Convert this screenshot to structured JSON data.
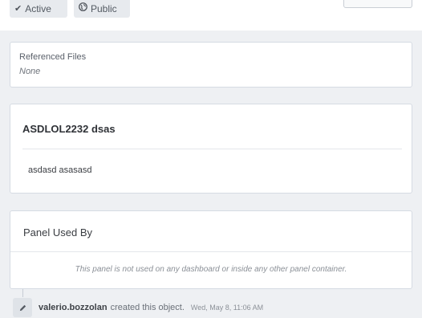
{
  "tags": {
    "active": {
      "icon": "checkmark-icon",
      "label": "Active"
    },
    "public": {
      "icon": "globe-icon",
      "label": "Public"
    }
  },
  "referenced_files": {
    "label": "Referenced Files",
    "value": "None"
  },
  "panel": {
    "title": "ASDLOL2232 dsas",
    "body": "asdasd asasasd"
  },
  "used_by": {
    "title": "Panel Used By",
    "empty_text": "This panel is not used on any dashboard or inside any other panel container."
  },
  "feed": {
    "icon": "pencil-icon",
    "user": "valerio.bozzolan",
    "action": "created this object.",
    "time": "Wed, May 8, 11:06 AM"
  }
}
